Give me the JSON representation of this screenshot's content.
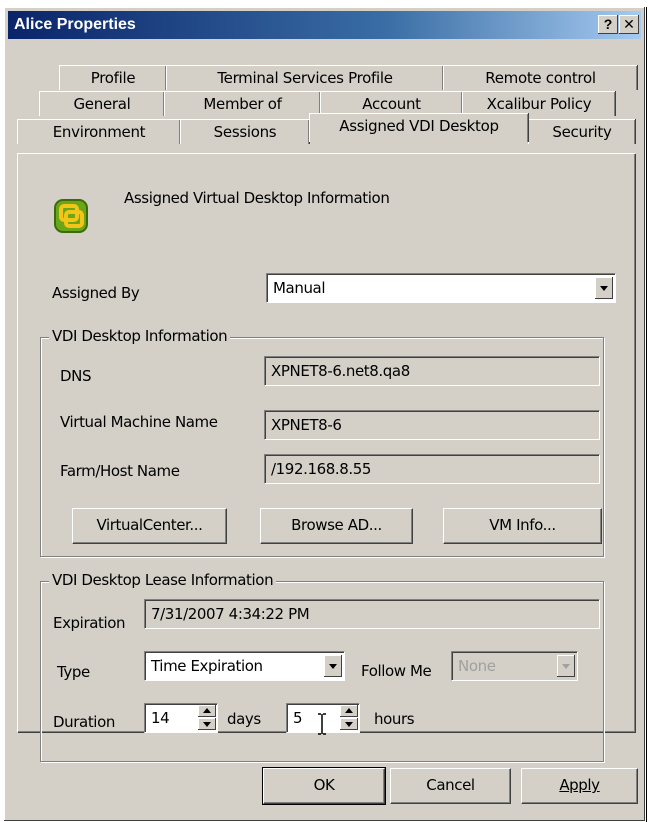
{
  "window": {
    "title": "Alice Properties",
    "help_glyph": "?",
    "close_glyph": "✕"
  },
  "tabs": {
    "row1": [
      "Profile",
      "Terminal Services Profile",
      "Remote control"
    ],
    "row2": [
      "General",
      "Member of",
      "Account",
      "Xcalibur Policy"
    ],
    "row3": [
      "Environment",
      "Sessions",
      "Assigned VDI Desktop",
      "Security"
    ],
    "active": "Assigned VDI Desktop"
  },
  "header": {
    "icon": "vmware-desktop-icon",
    "text": "Assigned Virtual Desktop Information"
  },
  "assigned_by": {
    "label": "Assigned By",
    "value": "Manual"
  },
  "desktop_info": {
    "title": "VDI Desktop Information",
    "dns_label": "DNS",
    "dns_value": "XPNET8-6.net8.qa8",
    "vm_label": "Virtual Machine Name",
    "vm_value": "XPNET8-6",
    "farm_label": "Farm/Host Name",
    "farm_value": "/192.168.8.55",
    "btn_virtualcenter": "VirtualCenter...",
    "btn_browse_ad": "Browse AD...",
    "btn_vm_info": "VM Info..."
  },
  "lease_info": {
    "title": "VDI Desktop Lease Information",
    "expiration_label": "Expiration",
    "expiration_value": "7/31/2007 4:34:22 PM",
    "type_label": "Type",
    "type_value": "Time Expiration",
    "follow_me_label": "Follow Me",
    "follow_me_value": "None",
    "duration_label": "Duration",
    "days_value": "14",
    "days_label": "days",
    "hours_value": "5",
    "hours_label": "hours"
  },
  "footer": {
    "ok": "OK",
    "cancel": "Cancel",
    "apply": "Apply"
  }
}
